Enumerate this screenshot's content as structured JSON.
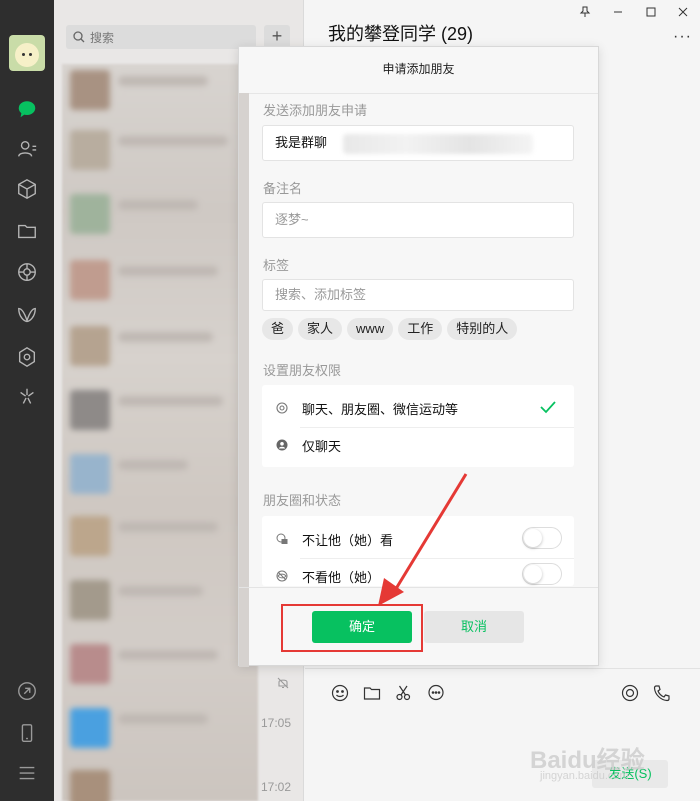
{
  "sidebar": {
    "icons": [
      "chat-icon",
      "contacts-icon",
      "favorites-icon",
      "files-icon",
      "moments-icon",
      "channels-icon",
      "mini-program-icon",
      "search-icon",
      "link-icon",
      "phone-icon",
      "menu-icon"
    ],
    "accent": "#07c160"
  },
  "list": {
    "search_placeholder": "搜索",
    "add_label": "+",
    "times": [
      "17:05",
      "17:02"
    ]
  },
  "chat": {
    "title": "我的攀登同学 (29)",
    "more_label": "···",
    "send_label": "发送(S)"
  },
  "dialog": {
    "title": "申请添加朋友",
    "request_label": "发送添加朋友申请",
    "request_value": "我是群聊",
    "remark_label": "备注名",
    "remark_placeholder": "逐梦~",
    "tags_label": "标签",
    "tags_placeholder": "搜索、添加标签",
    "tags": [
      "爸",
      "家人",
      "www",
      "工作",
      "特别的人"
    ],
    "permission_label": "设置朋友权限",
    "permissions": [
      {
        "label": "聊天、朋友圈、微信运动等",
        "selected": true
      },
      {
        "label": "仅聊天",
        "selected": false
      }
    ],
    "moments_label": "朋友圈和状态",
    "moments": [
      {
        "label": "不让他（她）看",
        "on": false
      },
      {
        "label": "不看他（她）",
        "on": false
      }
    ],
    "confirm_label": "确定",
    "cancel_label": "取消"
  },
  "watermark": {
    "main": "Baidu经验",
    "sub": "jingyan.baidu.com"
  }
}
